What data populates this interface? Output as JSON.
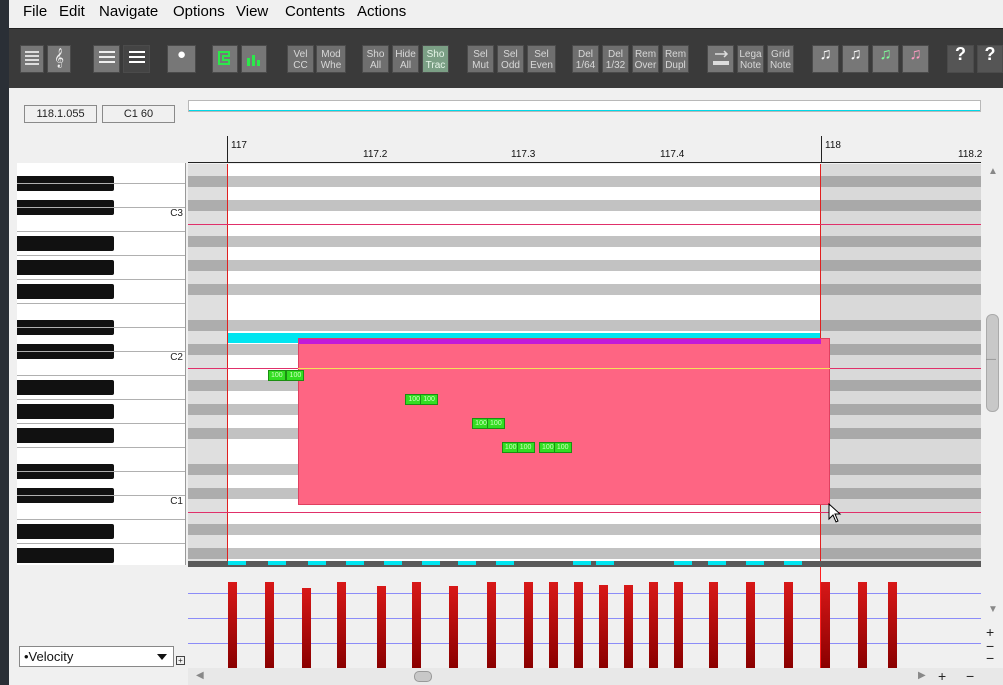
{
  "menu": [
    "File",
    "Edit",
    "Navigate",
    "Options",
    "View",
    "Contents",
    "Actions"
  ],
  "toolbar": {
    "vel_cc": [
      "Vel",
      "CC"
    ],
    "mod_whe": [
      "Mod",
      "Whe"
    ],
    "sho_all": [
      "Sho",
      "All"
    ],
    "hide_all": [
      "Hide",
      "All"
    ],
    "sho_trac": [
      "Sho",
      "Trac"
    ],
    "sel_mut": [
      "Sel",
      "Mut"
    ],
    "sel_odd": [
      "Sel",
      "Odd"
    ],
    "sel_even": [
      "Sel",
      "Even"
    ],
    "del_64": [
      "Del",
      "1/64"
    ],
    "del_32": [
      "Del",
      "1/32"
    ],
    "rem_over": [
      "Rem",
      "Over"
    ],
    "rem_dupl": [
      "Rem",
      "Dupl"
    ],
    "lega_note": [
      "Lega",
      "Note"
    ],
    "grid_note": [
      "Grid",
      "Note"
    ]
  },
  "position_display": "118.1.055",
  "pitch_display": "C1  60",
  "ruler": {
    "bar_labels": [
      "117",
      "118"
    ],
    "beat_labels": [
      "117.2",
      "117.3",
      "117.4",
      "118.2"
    ]
  },
  "keyboard": {
    "labels": [
      "C3",
      "C2",
      "C1"
    ]
  },
  "notes": {
    "velocity_label": "100",
    "items": [
      {
        "pitch_row": 0,
        "start_beat": 1.275,
        "velocity": 100
      },
      {
        "pitch_row": 0,
        "start_beat": 1.4,
        "velocity": 100
      },
      {
        "pitch_row": 1,
        "start_beat": 2.2,
        "velocity": 100
      },
      {
        "pitch_row": 1,
        "start_beat": 2.3,
        "velocity": 100
      },
      {
        "pitch_row": 2,
        "start_beat": 2.65,
        "velocity": 100
      },
      {
        "pitch_row": 2,
        "start_beat": 2.75,
        "velocity": 100
      },
      {
        "pitch_row": 3,
        "start_beat": 2.85,
        "velocity": 100
      },
      {
        "pitch_row": 3,
        "start_beat": 2.95,
        "velocity": 100
      },
      {
        "pitch_row": 3,
        "start_beat": 3.1,
        "velocity": 100
      },
      {
        "pitch_row": 3,
        "start_beat": 3.2,
        "velocity": 100
      }
    ]
  },
  "cc_lane": {
    "selected": "•Velocity",
    "velocities": [
      100,
      100,
      93,
      100,
      95,
      100,
      95,
      100,
      100,
      100,
      100,
      96,
      96,
      100,
      100,
      100,
      100,
      100,
      100,
      100,
      100
    ]
  },
  "colors": {
    "selection": "#fe6583",
    "note": "#33dd22",
    "playhead": "#ff2020",
    "velocity_bar": "#b31010",
    "cyan_bar": "#00e5f0",
    "purple_bar": "#c21ad8"
  }
}
